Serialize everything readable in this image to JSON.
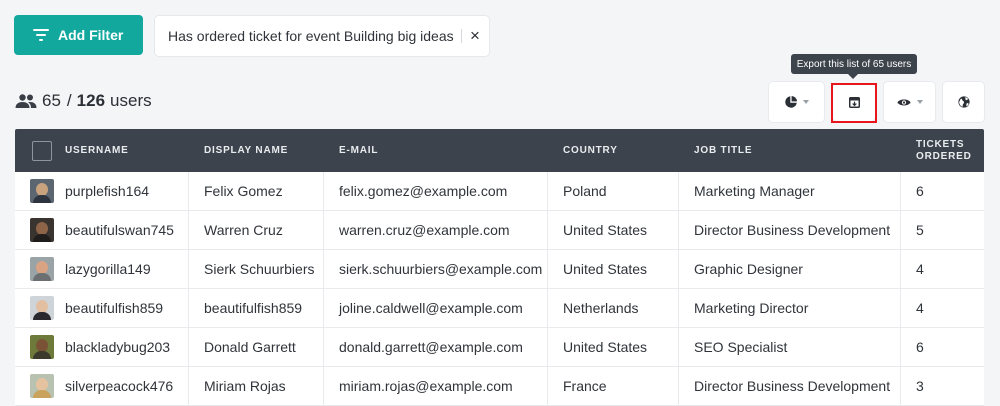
{
  "filter": {
    "add_label": "Add Filter",
    "active_filter": "Has ordered ticket for event Building big ideas",
    "close_symbol": "×"
  },
  "tooltip": "Export this list of 65 users",
  "count": {
    "filtered": "65",
    "separator": "/",
    "total": "126",
    "unit": "users"
  },
  "toolbar": {
    "icons": [
      "pie-chart-icon",
      "export-icon",
      "eye-icon",
      "globe-icon"
    ]
  },
  "colors": {
    "accent": "#13a89e",
    "header_bg": "#3d434c",
    "highlight": "#e8161c"
  },
  "table": {
    "columns": [
      "USERNAME",
      "DISPLAY NAME",
      "E-MAIL",
      "COUNTRY",
      "JOB TITLE",
      "TICKETS ORDERED"
    ],
    "rows": [
      {
        "username": "purplefish164",
        "display": "Felix Gomez",
        "email": "felix.gomez@example.com",
        "country": "Poland",
        "job": "Marketing Manager",
        "tickets": "6"
      },
      {
        "username": "beautifulswan745",
        "display": "Warren Cruz",
        "email": "warren.cruz@example.com",
        "country": "United States",
        "job": "Director Business Development",
        "tickets": "5"
      },
      {
        "username": "lazygorilla149",
        "display": "Sierk Schuurbiers",
        "email": "sierk.schuurbiers@example.com",
        "country": "United States",
        "job": "Graphic Designer",
        "tickets": "4"
      },
      {
        "username": "beautifulfish859",
        "display": "beautifulfish859",
        "email": "joline.caldwell@example.com",
        "country": "Netherlands",
        "job": "Marketing Director",
        "tickets": "4"
      },
      {
        "username": "blackladybug203",
        "display": "Donald Garrett",
        "email": "donald.garrett@example.com",
        "country": "United States",
        "job": "SEO Specialist",
        "tickets": "6"
      },
      {
        "username": "silverpeacock476",
        "display": "Miriam Rojas",
        "email": "miriam.rojas@example.com",
        "country": "France",
        "job": "Director Business Development",
        "tickets": "3"
      }
    ]
  }
}
